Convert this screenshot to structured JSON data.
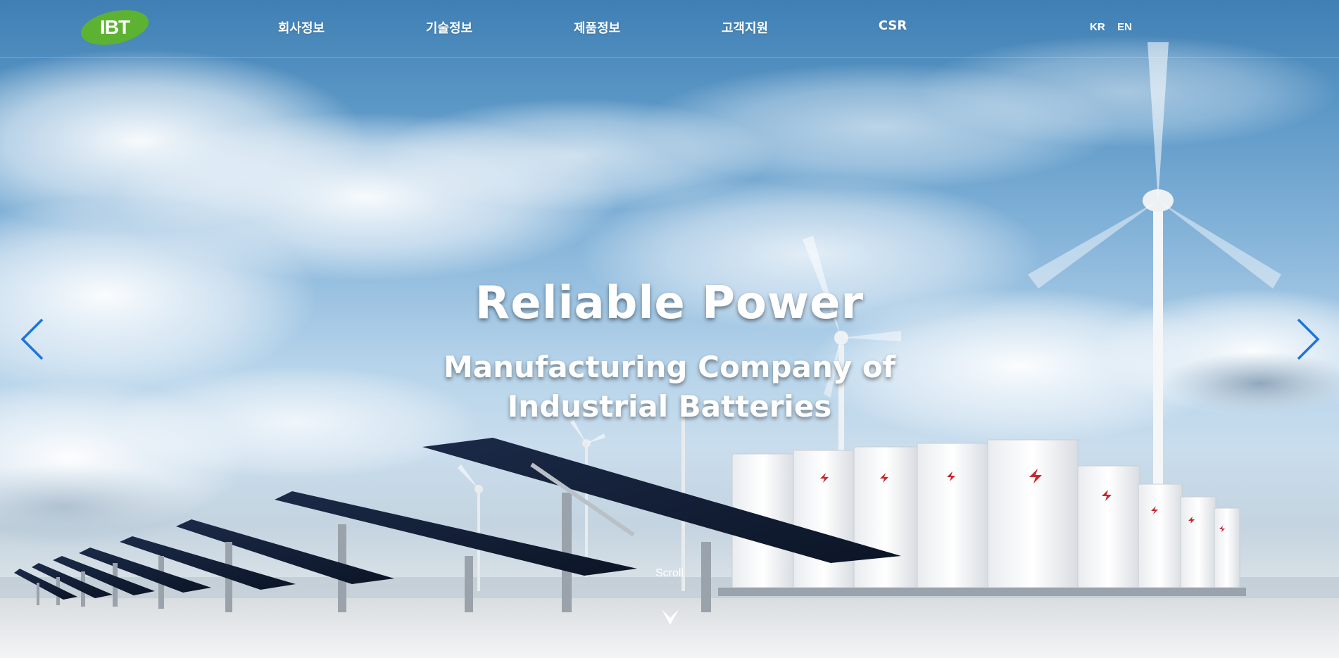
{
  "header": {
    "logo_text": "IBT",
    "nav": [
      "회사정보",
      "기술정보",
      "제품정보",
      "고객지원",
      "CSR"
    ],
    "languages": [
      "KR",
      "EN"
    ]
  },
  "hero": {
    "headline": "Reliable Power",
    "subheadline_line1": "Manufacturing Company of",
    "subheadline_line2": "Industrial Batteries",
    "scroll_label": "Scroll"
  },
  "colors": {
    "logo_green": "#5db232",
    "arrow_blue": "#1e74d8",
    "battery_red": "#c6282e"
  },
  "icons": {
    "prev": "chevron-left-icon",
    "next": "chevron-right-icon",
    "scroll": "chevron-down-icon"
  }
}
